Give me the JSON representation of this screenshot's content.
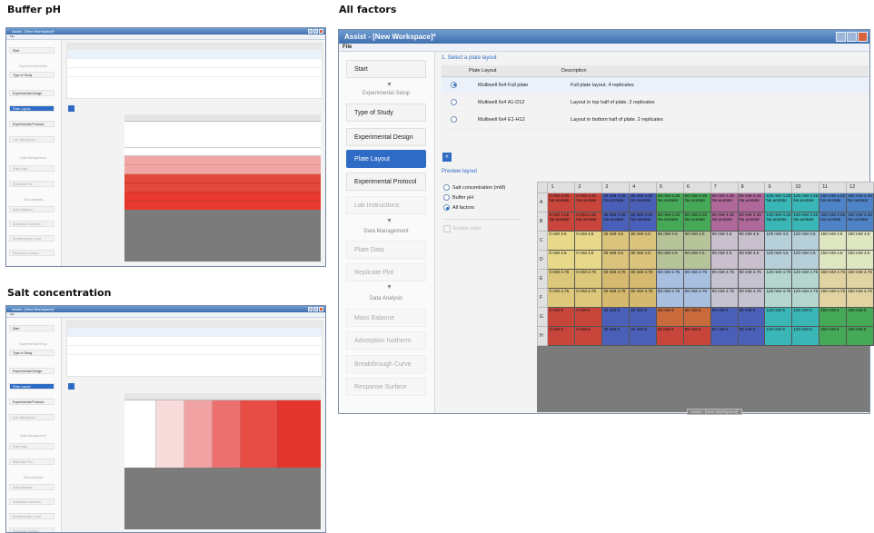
{
  "panels": {
    "buffer_ph": "Buffer pH",
    "all_factors": "All factors",
    "salt_concentration": "Salt concentration"
  },
  "app": {
    "title": "Assist - [New Workspace]*",
    "title_small": "Assist - [New Workspace]*",
    "menu": "File",
    "status": "Assist - [New Workspace]*"
  },
  "nav": {
    "start": "Start",
    "experimental_setup": "Experimental Setup",
    "type_of_study": "Type of Study",
    "experimental_design": "Experimental Design",
    "plate_layout": "Plate Layout",
    "experimental_protocol": "Experimental Protocol",
    "lab_instructions": "Lab Instructions",
    "data_management": "Data Management",
    "plate_data": "Plate Data",
    "replicate_plot": "Replicate Plot",
    "data_analysis": "Data Analysis",
    "mass_balance": "Mass Balance",
    "adsorption_isotherm": "Adsorption Isotherm",
    "breakthrough_curve": "Breakthrough Curve",
    "response_surface": "Response Surface"
  },
  "select_layout": {
    "label": "1. Select a plate layout",
    "col_layout": "Plate Layout",
    "col_desc": "Description",
    "rows": [
      {
        "name": "Multiwell 6x4 Full plate",
        "desc": "Full plate layout. 4 replicates",
        "selected": true
      },
      {
        "name": "Multiwell 6x4 A1-D12",
        "desc": "Layout in top half of plate. 2 replicates",
        "selected": false
      },
      {
        "name": "Multiwell 6x4 E1-H12",
        "desc": "Layout in bottom half of plate. 2 replicates",
        "selected": false
      }
    ]
  },
  "preview": {
    "label": "Preview layout",
    "options": [
      {
        "label": "Salt concentration (mM)",
        "selected": false
      },
      {
        "label": "Buffer pH",
        "selected": false
      },
      {
        "label": "All factors",
        "selected": true
      }
    ],
    "checkbox": "Enable color"
  },
  "plate": {
    "columns": [
      "1",
      "2",
      "3",
      "4",
      "5",
      "6",
      "7",
      "8",
      "9",
      "10",
      "11",
      "12"
    ],
    "rows": [
      "A",
      "B",
      "C",
      "D",
      "E",
      "F",
      "G",
      "H"
    ],
    "cells": [
      [
        "0 mM 4.25 Na acetate",
        "0 mM 4.25 Na acetate",
        "30 mM 4.25 Na acetate",
        "30 mM 4.25 Na acetate",
        "60 mM 4.25 Na acetate",
        "60 mM 4.25 Na acetate",
        "90 mM 4.25 Na acetate",
        "90 mM 4.25 Na acetate",
        "120 mM 4.25 Na acetate",
        "120 mM 4.25 Na acetate",
        "150 mM 4.25 Na acetate",
        "150 mM 4.25 Na acetate"
      ],
      [
        "0 mM 4.25 Na acetate",
        "0 mM 4.25 Na acetate",
        "30 mM 4.25 Na acetate",
        "30 mM 4.25 Na acetate",
        "60 mM 4.25 Na acetate",
        "60 mM 4.25 Na acetate",
        "90 mM 4.25 Na acetate",
        "90 mM 4.25 Na acetate",
        "120 mM 4.25 Na acetate",
        "120 mM 4.25 Na acetate",
        "150 mM 4.25 Na acetate",
        "150 mM 4.25 Na acetate"
      ],
      [
        "0 mM 4.5",
        "0 mM 4.5",
        "30 mM 4.5",
        "30 mM 4.5",
        "60 mM 4.5",
        "60 mM 4.5",
        "90 mM 4.5",
        "90 mM 4.5",
        "120 mM 4.5",
        "120 mM 4.5",
        "150 mM 4.5",
        "150 mM 4.5"
      ],
      [
        "0 mM 4.5",
        "0 mM 4.5",
        "30 mM 4.5",
        "30 mM 4.5",
        "60 mM 4.5",
        "60 mM 4.5",
        "90 mM 4.5",
        "90 mM 4.5",
        "120 mM 4.5",
        "120 mM 4.5",
        "150 mM 4.5",
        "150 mM 4.5"
      ],
      [
        "0 mM 4.75",
        "0 mM 4.75",
        "30 mM 4.75",
        "30 mM 4.75",
        "60 mM 4.75",
        "60 mM 4.75",
        "90 mM 4.75",
        "90 mM 4.75",
        "120 mM 4.75",
        "120 mM 4.75",
        "150 mM 4.75",
        "150 mM 4.75"
      ],
      [
        "0 mM 4.75",
        "0 mM 4.75",
        "30 mM 4.75",
        "30 mM 4.75",
        "60 mM 4.75",
        "60 mM 4.75",
        "90 mM 4.75",
        "90 mM 4.75",
        "120 mM 4.75",
        "120 mM 4.75",
        "150 mM 4.75",
        "150 mM 4.75"
      ],
      [
        "0 mM 5",
        "0 mM 5",
        "30 mM 5",
        "30 mM 5",
        "60 mM 5",
        "60 mM 5",
        "90 mM 5",
        "90 mM 5",
        "120 mM 5",
        "120 mM 5",
        "150 mM 5",
        "150 mM 5"
      ],
      [
        "0 mM 5",
        "0 mM 5",
        "30 mM 5",
        "30 mM 5",
        "60 mM 5",
        "60 mM 5",
        "90 mM 5",
        "90 mM 5",
        "120 mM 5",
        "120 mM 5",
        "150 mM 5",
        "150 mM 5"
      ]
    ],
    "colors": {
      "A": [
        "#c8453c",
        "#c8453c",
        "#4a5fb8",
        "#4a5fb8",
        "#45a957",
        "#45a957",
        "#b0679a",
        "#b0679a",
        "#3bb6b7",
        "#3bb6b7",
        "#4f83c7",
        "#4f83c7"
      ],
      "B": [
        "#c8453c",
        "#c8453c",
        "#4a5fb8",
        "#4a5fb8",
        "#45a957",
        "#45a957",
        "#b0679a",
        "#b0679a",
        "#3bb6b7",
        "#3bb6b7",
        "#4f83c7",
        "#4f83c7"
      ],
      "C": [
        "#e7d88a",
        "#e7d88a",
        "#dac37a",
        "#dac37a",
        "#b7c49a",
        "#b7c49a",
        "#c8c0cc",
        "#c8c0cc",
        "#b6cfd9",
        "#b6cfd9",
        "#dfe7c2",
        "#dfe7c2"
      ],
      "D": [
        "#e7d88a",
        "#e7d88a",
        "#dac37a",
        "#dac37a",
        "#b7c49a",
        "#b7c49a",
        "#c8c0cc",
        "#c8c0cc",
        "#b6cfd9",
        "#b6cfd9",
        "#dfe7c2",
        "#dfe7c2"
      ],
      "E": [
        "#dcc77a",
        "#dcc77a",
        "#d4b96e",
        "#d4b96e",
        "#a8bfe0",
        "#a8bfe0",
        "#c6c3d1",
        "#c6c3d1",
        "#b5d6cf",
        "#b5d6cf",
        "#e1d4a2",
        "#e1d4a2"
      ],
      "F": [
        "#dcc77a",
        "#dcc77a",
        "#d4b96e",
        "#d4b96e",
        "#a8bfe0",
        "#a8bfe0",
        "#c6c3d1",
        "#c6c3d1",
        "#b5d6cf",
        "#b5d6cf",
        "#e1d4a2",
        "#e1d4a2"
      ],
      "G": [
        "#c8453c",
        "#c8453c",
        "#4a5fb8",
        "#4a5fb8",
        "#c86a3c",
        "#c86a3c",
        "#4a5fb8",
        "#4a5fb8",
        "#3bb6b7",
        "#3bb6b7",
        "#45a957",
        "#45a957"
      ],
      "H": [
        "#c8453c",
        "#c8453c",
        "#4a5fb8",
        "#4a5fb8",
        "#c8453c",
        "#c8453c",
        "#4a5fb8",
        "#4a5fb8",
        "#3bb6b7",
        "#3bb6b7",
        "#45a957",
        "#45a957"
      ]
    }
  }
}
